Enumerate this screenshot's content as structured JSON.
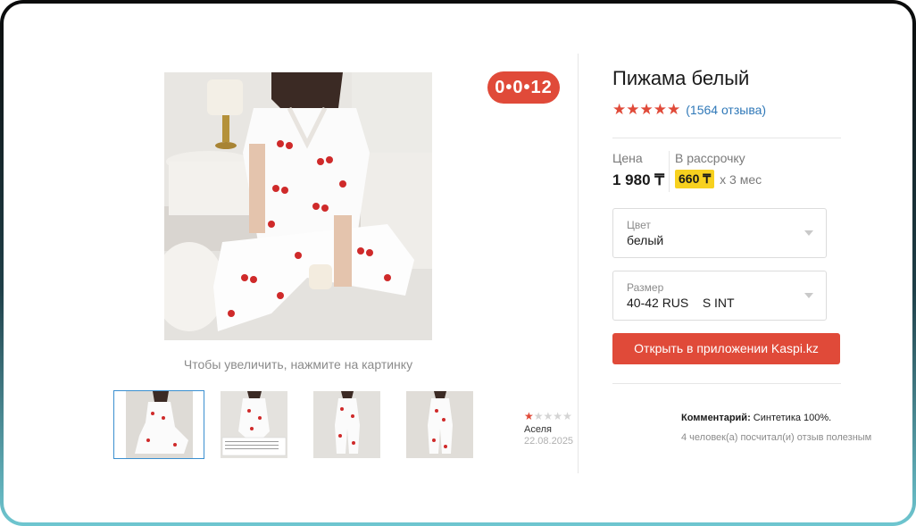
{
  "product": {
    "title": "Пижама белый",
    "rating_stars": 5,
    "reviews_link": "(1564 отзыва)",
    "timer": "0•0•12",
    "zoom_hint": "Чтобы увеличить, нажмите на картинку",
    "thumbnails": [
      "thumb-1",
      "thumb-2",
      "thumb-3",
      "thumb-4"
    ]
  },
  "price": {
    "label": "Цена",
    "value": "1 980 ₸",
    "installment_label": "В рассрочку",
    "installment_amount": "660 ₸",
    "installment_months": "х 3 мес"
  },
  "color_select": {
    "label": "Цвет",
    "value": "белый"
  },
  "size_select": {
    "label": "Размер",
    "value": "40-42 RUS    S INT"
  },
  "open_app_button": "Открыть в приложении Kaspi.kz",
  "review": {
    "rating": 1,
    "author": "Аселя",
    "date": "22.08.2025",
    "comment_label": "Комментарий:",
    "comment_text": " Синтетика 100%.",
    "helpful": "4 человек(а) посчитал(и) отзыв полезным"
  },
  "colors": {
    "accent_red": "#e04a39",
    "link_blue": "#2f78b8",
    "installment_yellow": "#f7d11f"
  }
}
